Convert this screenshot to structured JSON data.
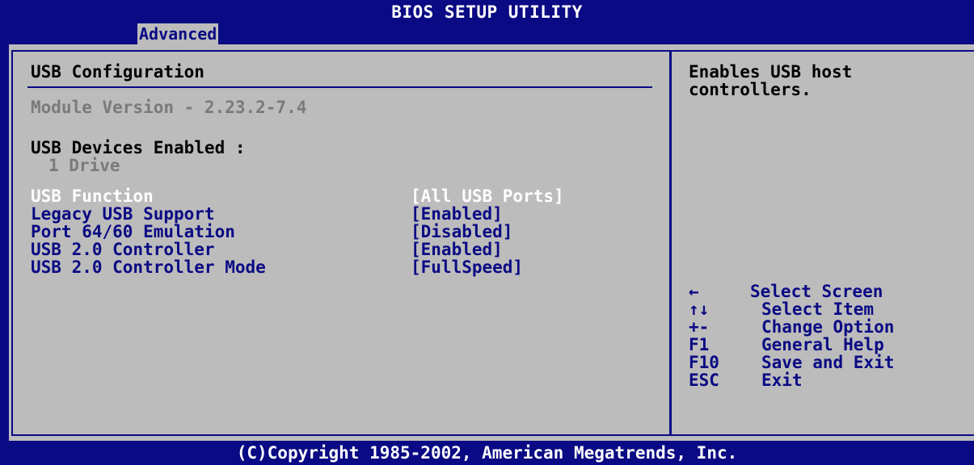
{
  "header": {
    "title": "BIOS SETUP UTILITY",
    "active_tab": "Advanced"
  },
  "section": {
    "title": "USB Configuration",
    "module_version": "Module Version - 2.23.2-7.4",
    "devices_label": "USB Devices Enabled :",
    "devices_value": "1 Drive"
  },
  "settings": [
    {
      "label": "USB Function",
      "value": "[All USB Ports]",
      "selected": true
    },
    {
      "label": "Legacy USB Support",
      "value": "[Enabled]",
      "selected": false
    },
    {
      "label": "Port 64/60 Emulation",
      "value": "[Disabled]",
      "selected": false
    },
    {
      "label": "USB 2.0 Controller",
      "value": "[Enabled]",
      "selected": false
    },
    {
      "label": "USB 2.0 Controller Mode",
      "value": "[FullSpeed]",
      "selected": false
    }
  ],
  "help": {
    "text_line1": "Enables USB host",
    "text_line2": "controllers."
  },
  "keys": [
    {
      "key": "←",
      "action": "Select Screen"
    },
    {
      "key": "↑↓",
      "action": "Select Item"
    },
    {
      "key": "+-",
      "action": "Change Option"
    },
    {
      "key": "F1",
      "action": "General Help"
    },
    {
      "key": "F10",
      "action": "Save and Exit"
    },
    {
      "key": "ESC",
      "action": "Exit"
    }
  ],
  "footer": {
    "copyright": "(C)Copyright 1985-2002, American Megatrends, Inc."
  },
  "colors": {
    "background_blue": "#0a0a84",
    "panel_gray": "#bcbcbc",
    "selected_text": "#ffffff",
    "disabled_text": "#7a7a7a"
  }
}
